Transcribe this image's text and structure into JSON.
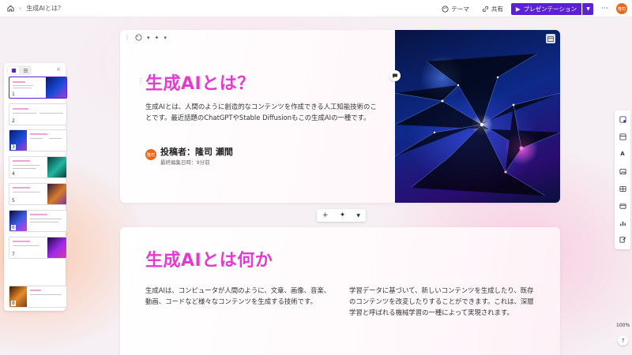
{
  "topbar": {
    "breadcrumb_title": "生成AIとは？",
    "theme_label": "テーマ",
    "share_label": "共有",
    "present_label": "プレゼンテーション",
    "avatar_text": "隆司"
  },
  "slide1": {
    "title": "生成AIとは？",
    "body": "生成AIとは、人間のように創造的なコンテンツを作成できる人工知能技術のことです。最近話題のChatGPTやStable Diffusionもこの生成AIの一種です。",
    "author_avatar": "隆司",
    "author": "投稿者：隆司 瀬間",
    "last_edited": "最終編集日時：9分前"
  },
  "slide2": {
    "title": "生成AIとは何か",
    "col1": "生成AIは、コンピュータが人間のように、文章、画像、音楽、動画、コードなど様々なコンテンツを生成する技術です。",
    "col2": "学習データに基づいて、新しいコンテンツを生成したり、既存のコンテンツを改変したりすることができます。これは、深層学習と呼ばれる機械学習の一種によって実現されます。"
  },
  "thumbnails": {
    "numbers": [
      "1",
      "2",
      "3",
      "4",
      "5",
      "6",
      "7",
      "8"
    ]
  },
  "zoom": "100%",
  "help": "?",
  "colors": {
    "accent": "#5b21d6",
    "title_pink": "#e23bd0",
    "avatar": "#e9691c"
  }
}
